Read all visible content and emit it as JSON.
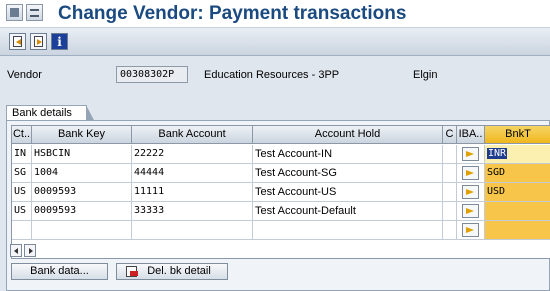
{
  "window": {
    "title": "Change Vendor: Payment transactions"
  },
  "vendor": {
    "label": "Vendor",
    "number": "00308302P",
    "name": "Education Resources - 3PP",
    "city": "Elgin"
  },
  "tab": {
    "label": "Bank details"
  },
  "table": {
    "headers": {
      "ctry": "Ct..",
      "bank_key": "Bank Key",
      "bank_account": "Bank Account",
      "account_holder": "Account Hold",
      "c": "C",
      "iban": "IBA..",
      "bnkt": "BnkT"
    },
    "rows": [
      {
        "ctry": "IN",
        "bank_key": "HSBCIN",
        "bank_account": "22222",
        "account_holder": "Test Account-IN",
        "bnkt": "INR"
      },
      {
        "ctry": "SG",
        "bank_key": "1004",
        "bank_account": "44444",
        "account_holder": "Test Account-SG",
        "bnkt": "SGD"
      },
      {
        "ctry": "US",
        "bank_key": "0009593",
        "bank_account": "11111",
        "account_holder": "Test Account-US",
        "bnkt": "USD"
      },
      {
        "ctry": "US",
        "bank_key": "0009593",
        "bank_account": "33333",
        "account_holder": "Test Account-Default",
        "bnkt": ""
      },
      {
        "ctry": "",
        "bank_key": "",
        "bank_account": "",
        "account_holder": "",
        "bnkt": ""
      }
    ]
  },
  "buttons": {
    "bank_data": "Bank data...",
    "delete_bank_detail": "Del. bk detail"
  },
  "colors": {
    "title": "#1b4a80",
    "bnkt_column": "#f6c54a",
    "selection": "#1f3c8f"
  }
}
